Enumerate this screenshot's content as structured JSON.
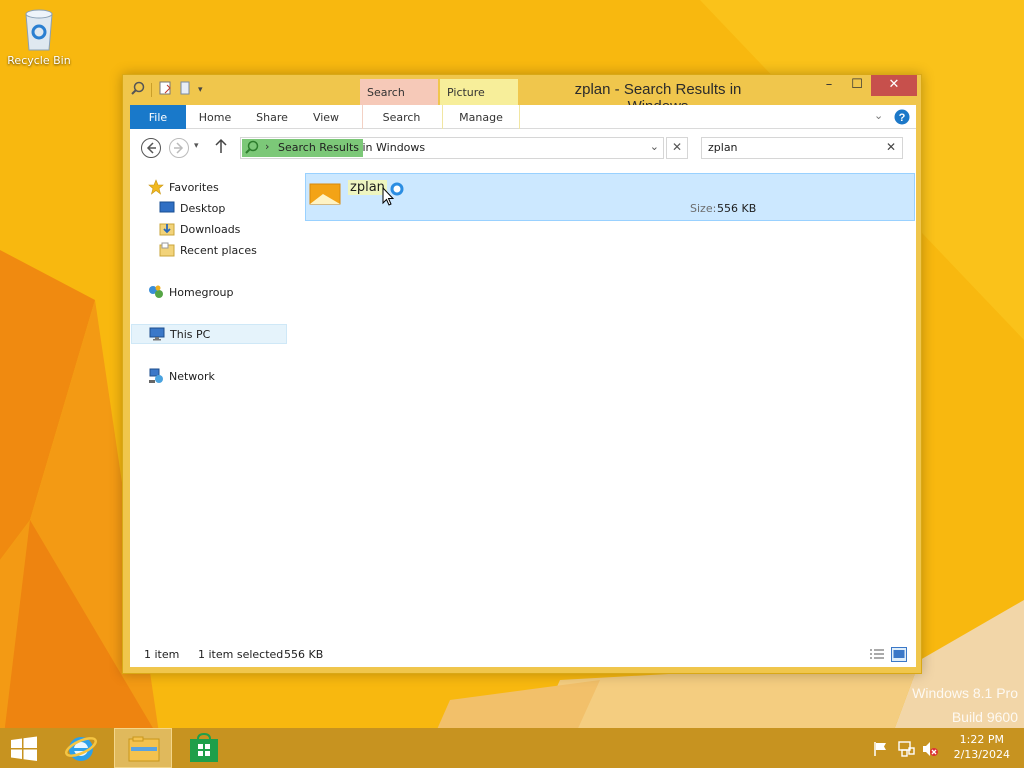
{
  "desktop": {
    "recycle_bin_label": "Recycle Bin",
    "watermark_line1": "Windows 8.1 Pro",
    "watermark_line2": "Build 9600"
  },
  "window": {
    "title": "zplan - Search Results in Windows",
    "context_tabs": {
      "search_tools": "Search Tools",
      "picture_tools": "Picture Tools"
    },
    "caption": {
      "minimize": "–",
      "maximize": "☐",
      "close": "✕"
    }
  },
  "ribbon": {
    "tabs": [
      {
        "label": "File"
      },
      {
        "label": "Home"
      },
      {
        "label": "Share"
      },
      {
        "label": "View"
      },
      {
        "label": "Search"
      },
      {
        "label": "Manage"
      }
    ]
  },
  "address_bar": {
    "path": "Search Results in Windows",
    "separator": "›"
  },
  "search_box": {
    "value": "zplan",
    "clear": "✕"
  },
  "nav_pane": {
    "favorites": "Favorites",
    "desktop": "Desktop",
    "downloads": "Downloads",
    "recent_places": "Recent places",
    "homegroup": "Homegroup",
    "this_pc": "This PC",
    "network": "Network"
  },
  "results": [
    {
      "name": "zplan",
      "size_label": "Size:",
      "size": "556 KB"
    }
  ],
  "status_bar": {
    "item_count": "1 item",
    "selection": "1 item selected",
    "selection_size": "556 KB"
  },
  "taskbar": {
    "time": "1:22 PM",
    "date": "2/13/2024"
  },
  "colors": {
    "accent_file_tab": "#1979ca",
    "selection_bg": "#cce8ff",
    "close_button": "#c7504c",
    "desktop": "#f7b60f"
  }
}
